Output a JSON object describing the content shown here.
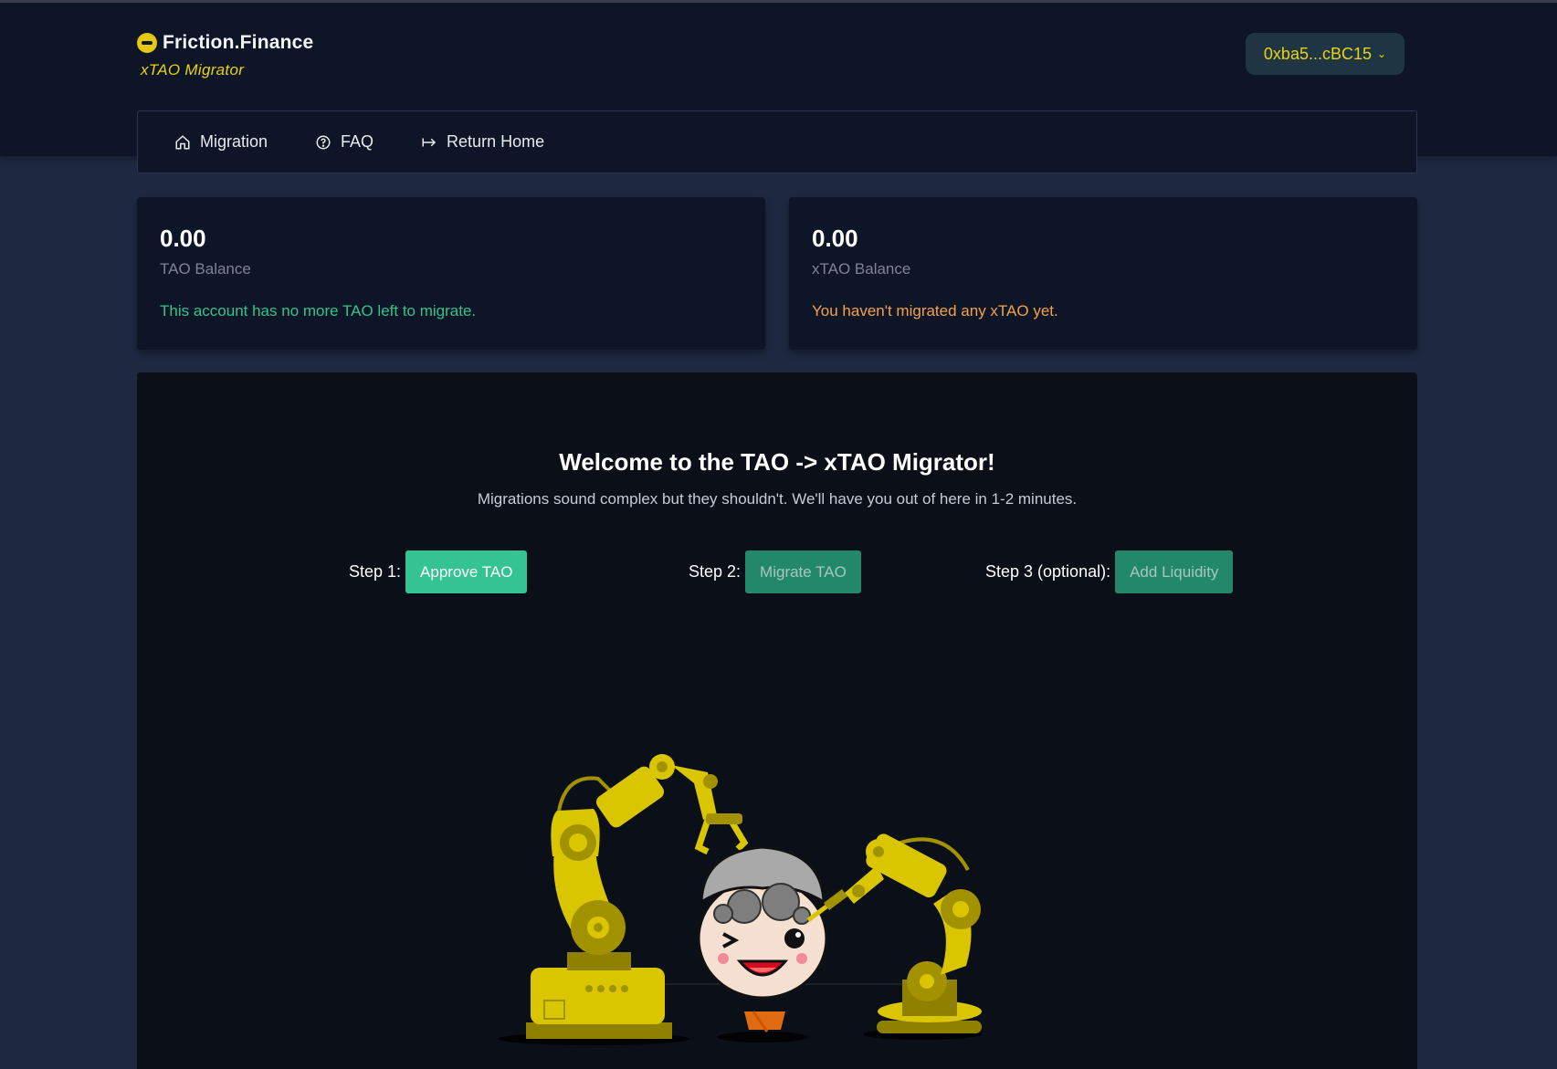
{
  "app": {
    "brand_name": "Friction.Finance",
    "subtitle": "xTAO Migrator",
    "wallet_address": "0xba5...cBC15"
  },
  "nav": {
    "items": [
      {
        "label": "Migration",
        "icon": "home-icon"
      },
      {
        "label": "FAQ",
        "icon": "question-circle-icon"
      },
      {
        "label": "Return Home",
        "icon": "arrow-right-to-bar-icon"
      }
    ]
  },
  "balances": {
    "tao": {
      "amount": "0.00",
      "label": "TAO Balance",
      "message": "This account has no more TAO left to migrate."
    },
    "xtao": {
      "amount": "0.00",
      "label": "xTAO Balance",
      "message": "You haven't migrated any xTAO yet."
    }
  },
  "main": {
    "title": "Welcome to the TAO -> xTAO Migrator!",
    "subtitle": "Migrations sound complex but they shouldn't. We'll have you out of here in 1-2 minutes.",
    "steps": [
      {
        "label": "Step 1:",
        "button": "Approve TAO",
        "state": "active"
      },
      {
        "label": "Step 2:",
        "button": "Migrate TAO",
        "state": "disabled"
      },
      {
        "label": "Step 3 (optional):",
        "button": "Add Liquidity",
        "state": "disabled"
      }
    ]
  },
  "colors": {
    "accent_yellow": "#e9d20e",
    "success_green": "#34c393",
    "warning_orange": "#f4a14a",
    "panel_bg": "#0e1527",
    "page_bg": "#1e2841"
  }
}
